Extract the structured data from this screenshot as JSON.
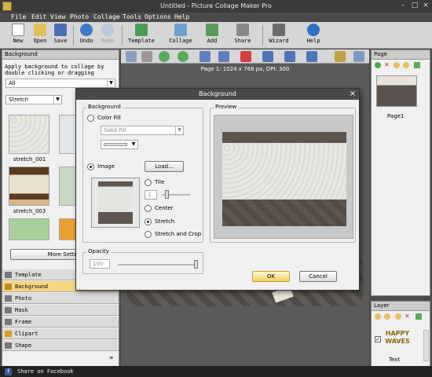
{
  "window": {
    "title": "Untitled - Picture Collage Maker Pro"
  },
  "menu": [
    "File",
    "Edit",
    "View",
    "Photo",
    "Collage",
    "Tools",
    "Options",
    "Help"
  ],
  "toolbar": [
    {
      "name": "new",
      "label": "New"
    },
    {
      "name": "open",
      "label": "Open"
    },
    {
      "name": "save",
      "label": "Save"
    },
    {
      "name": "undo",
      "label": "Undo"
    },
    {
      "name": "redo",
      "label": "Redo"
    },
    {
      "name": "template",
      "label": "Template"
    },
    {
      "name": "collage",
      "label": "Collage"
    },
    {
      "name": "add",
      "label": "Add"
    },
    {
      "name": "share",
      "label": "Share"
    },
    {
      "name": "wizard",
      "label": "Wizard"
    },
    {
      "name": "help",
      "label": "Help"
    }
  ],
  "left_panel": {
    "header": "Background",
    "description": "Apply background to collage by double clicking or dragging",
    "filter_value": "All",
    "mode_value": "Stretch",
    "thumbnails": [
      {
        "label": "stretch_001"
      },
      {
        "label": ""
      },
      {
        "label": "stretch_003"
      },
      {
        "label": ""
      }
    ],
    "more_button": "More Setting",
    "tabs": [
      "Template",
      "Background",
      "Photo",
      "Mask",
      "Frame",
      "Clipart",
      "Shape"
    ],
    "active_tab": "Background"
  },
  "canvas": {
    "page_info": "Page 1: 1024 x 768 px, DPI: 300"
  },
  "page_panel": {
    "header": "Page",
    "page_label": "Page1"
  },
  "layer_panel": {
    "header": "Layer",
    "layer_text_line1": "HAPPY",
    "layer_text_line2": "WAVES",
    "layer_label": "Text"
  },
  "status": {
    "share": "Share on Facebook"
  },
  "dialog": {
    "title": "Background",
    "close": "×",
    "group_background": "Background",
    "color_fill": "Color Fill",
    "fill_type": "Solid Fill",
    "image": "Image",
    "load": "Load...",
    "tile": "Tile",
    "tile_value": "1",
    "center": "Center",
    "stretch": "Stretch",
    "stretch_crop": "Stretch and Crop",
    "group_opacity": "Opacity",
    "opacity_value": "100",
    "opacity_fraction": 1.0,
    "group_preview": "Preview",
    "ok": "OK",
    "cancel": "Cancel"
  }
}
